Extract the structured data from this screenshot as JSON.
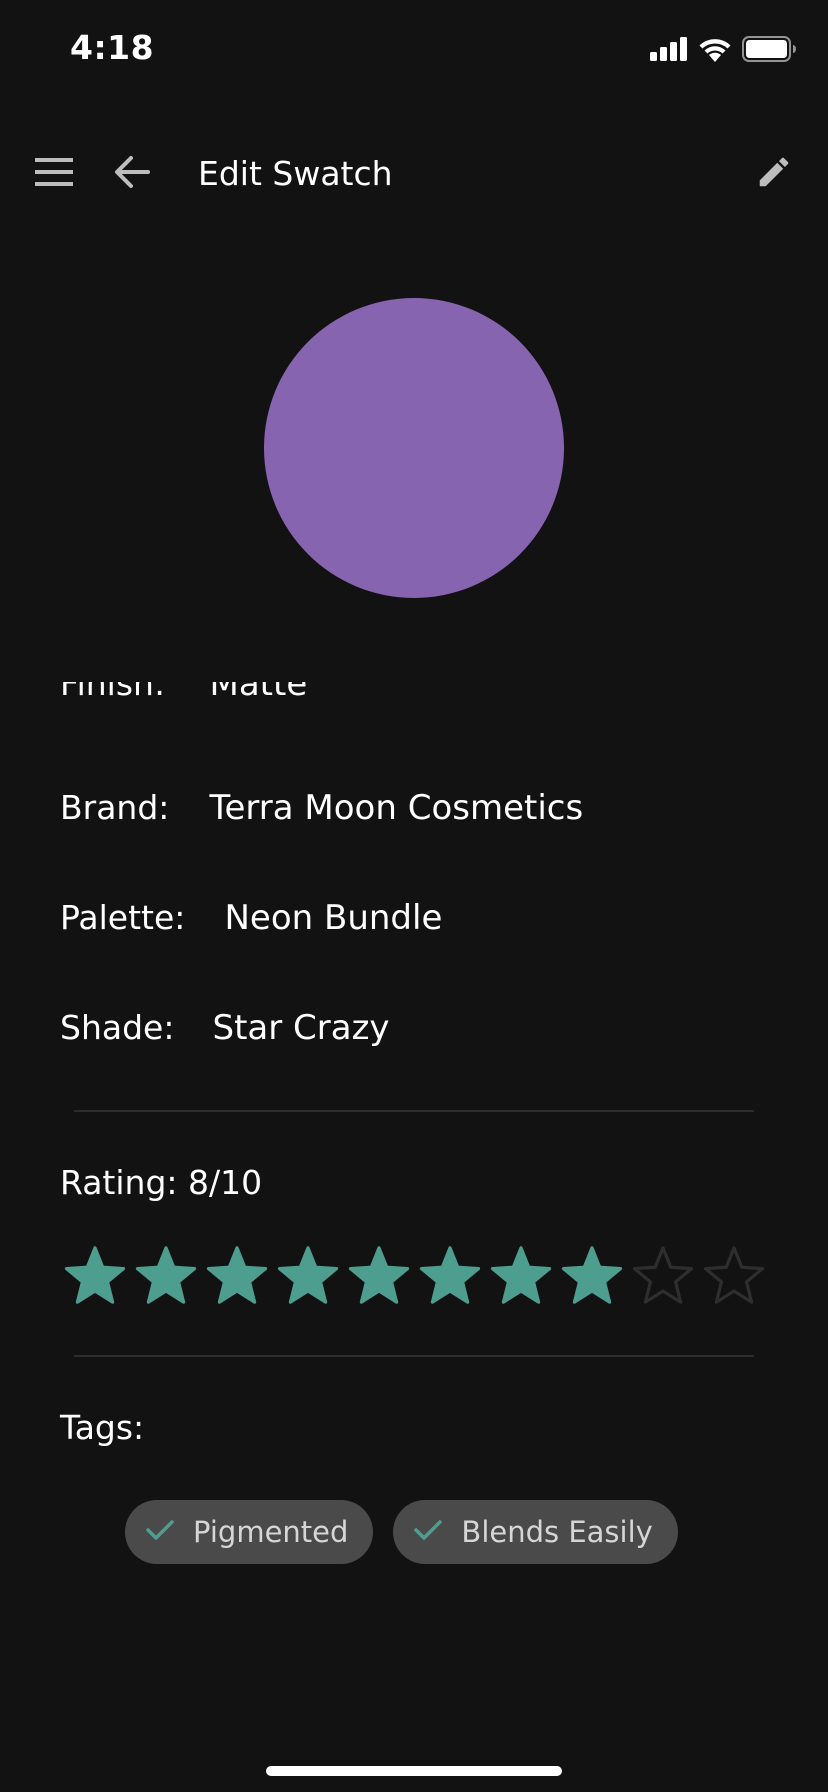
{
  "status_bar": {
    "time": "4:18"
  },
  "app_bar": {
    "title": "Edit Swatch",
    "menu_icon": "hamburger-menu-icon",
    "back_icon": "arrow-left-icon",
    "edit_icon": "pencil-icon"
  },
  "swatch": {
    "color": "#8764B0"
  },
  "details": [
    {
      "label": "Finish:",
      "value": "Matte"
    },
    {
      "label": "Brand:",
      "value": "Terra Moon Cosmetics"
    },
    {
      "label": "Palette:",
      "value": "Neon Bundle"
    },
    {
      "label": "Shade:",
      "value": "Star Crazy"
    }
  ],
  "rating": {
    "text": "Rating: 8/10",
    "value": 8,
    "max": 10,
    "filled_color": "#4E9E8F",
    "empty_color": "#2E2E2E"
  },
  "tags": {
    "label": "Tags:",
    "items": [
      {
        "label": "Pigmented",
        "icon": "check-icon"
      },
      {
        "label": "Blends Easily",
        "icon": "check-icon"
      }
    ],
    "check_color": "#4E9E8F"
  },
  "colors": {
    "background": "#121212",
    "text": "#FFFFFF",
    "chip_background": "#4A4A4A",
    "divider": "#2D2D2D"
  }
}
